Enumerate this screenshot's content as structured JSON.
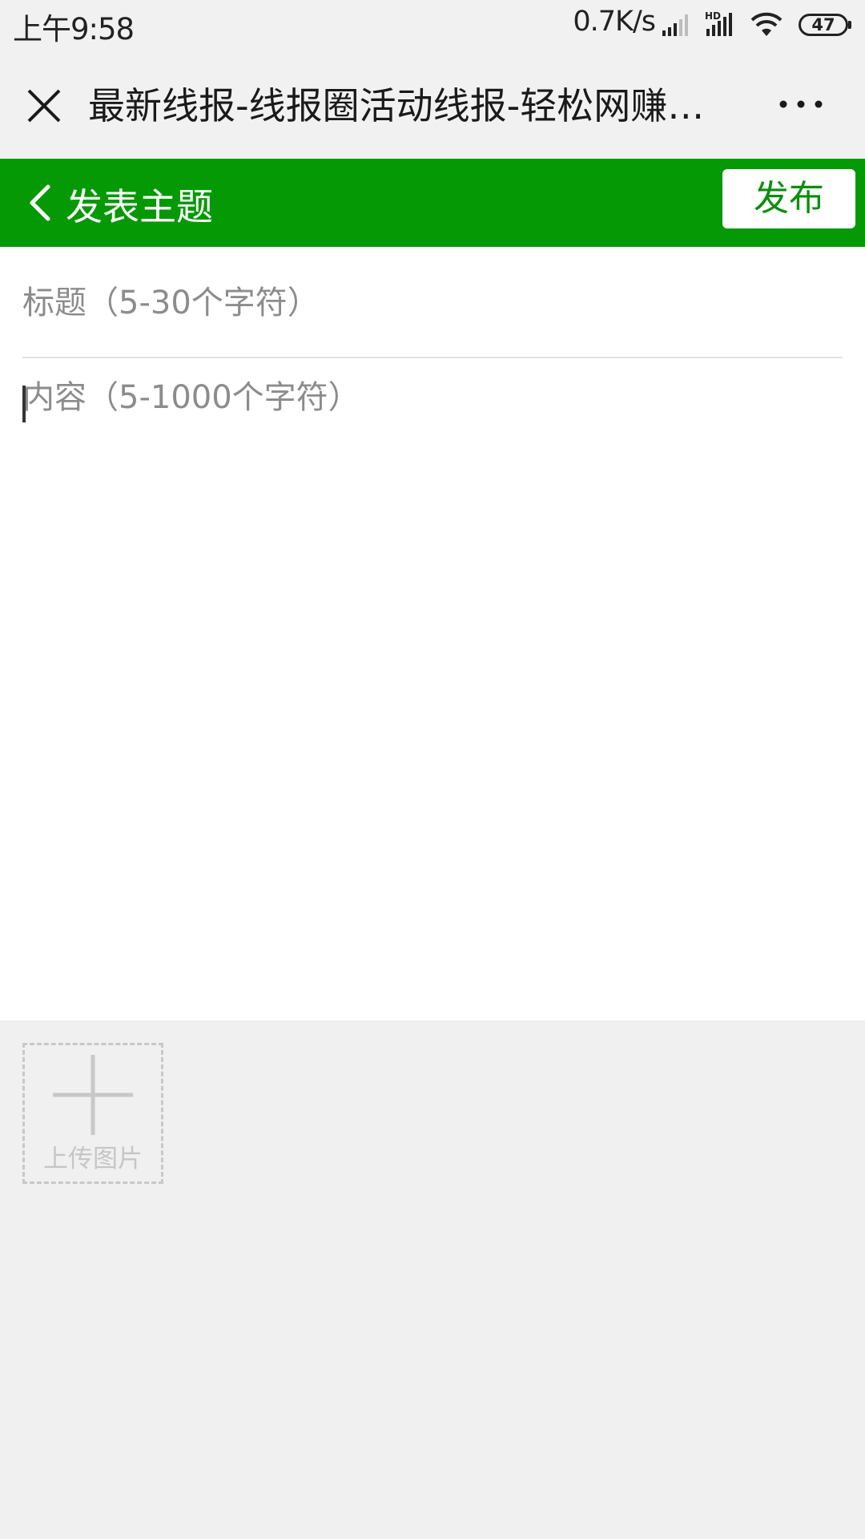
{
  "status_bar": {
    "time": "上午9:58",
    "network_speed": "0.7K/s",
    "hd_label": "HD",
    "battery": "47",
    "icons": [
      "signal-icon",
      "signal-hd-icon",
      "wifi-icon",
      "battery-icon"
    ]
  },
  "window": {
    "title": "最新线报-线报圈活动线报-轻松网赚…",
    "close_icon": "close-icon",
    "more_icon": "more-icon"
  },
  "header": {
    "title": "发表主题",
    "back_icon": "chevron-left-icon",
    "publish_label": "发布",
    "accent_color": "#059a05"
  },
  "form": {
    "title_placeholder": "标题（5-30个字符）",
    "title_value": "",
    "content_placeholder": "内容（5-1000个字符）",
    "content_value": ""
  },
  "upload": {
    "label": "上传图片",
    "icon": "plus-icon"
  }
}
